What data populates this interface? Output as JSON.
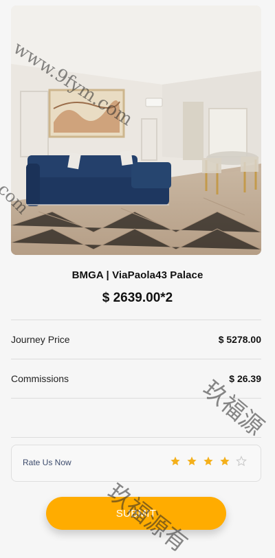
{
  "listing": {
    "title": "BMGA | ViaPaola43 Palace",
    "price": "$ 2639.00*2",
    "image_alt": "Living room with blue sofa"
  },
  "summary": {
    "journey_price_label": "Journey Price",
    "journey_price_value": "$ 5278.00",
    "commissions_label": "Commissions",
    "commissions_value": "$ 26.39"
  },
  "rating": {
    "label": "Rate Us Now",
    "stars_filled": 4,
    "stars_total": 5,
    "star_color": "#f4b01b"
  },
  "actions": {
    "submit_label": "SUBMIT",
    "accent": "#ffac00"
  },
  "watermarks": {
    "top": "www.9fym.com",
    "left": "m.com",
    "right": "玖福源",
    "bottom": "玖福源有"
  }
}
